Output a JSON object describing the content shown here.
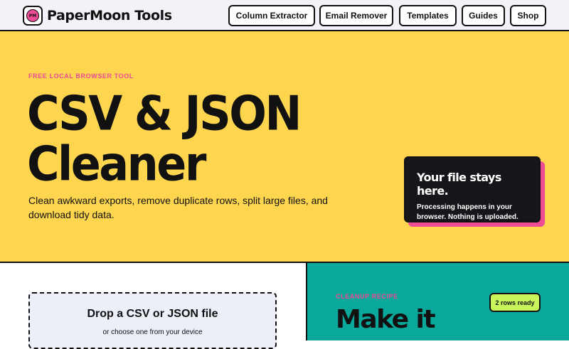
{
  "brand": {
    "name": "PaperMoon Tools",
    "logo_mark": "PM",
    "icon": "moon-logo-icon"
  },
  "nav": [
    {
      "label": "Column Extractor"
    },
    {
      "label": "Email Remover"
    },
    {
      "label": "Templates"
    },
    {
      "label": "Guides"
    },
    {
      "label": "Shop"
    }
  ],
  "hero": {
    "eyebrow": "FREE LOCAL BROWSER TOOL",
    "title": "CSV & JSON Cleaner",
    "subtitle": "Clean awkward exports, remove duplicate rows, split large files, and download tidy data."
  },
  "privacy": {
    "title": "Your file stays here.",
    "text": "Processing happens in your browser. Nothing is uploaded."
  },
  "dropzone": {
    "title": "Drop a CSV or JSON file",
    "subtitle": "or choose one from your device"
  },
  "recipe": {
    "eyebrow": "CLEANUP RECIPE",
    "title": "Make it",
    "rows_badge": "2 rows ready"
  },
  "colors": {
    "hero_bg": "#fdd54f",
    "accent_pink": "#ee4b97",
    "teal": "#0aa79b",
    "lime": "#c8f55a",
    "dark": "#16161a"
  }
}
